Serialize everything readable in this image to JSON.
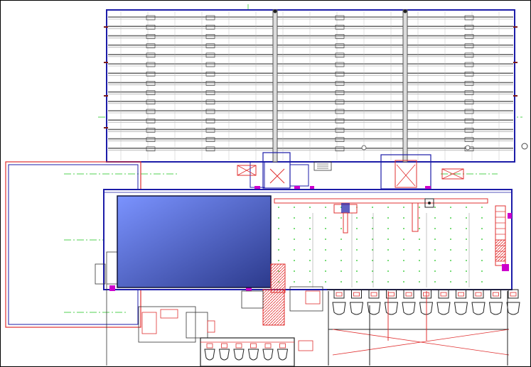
{
  "drawing": {
    "type": "cad-floor-plan",
    "colors": {
      "background": "#ffffff",
      "frame": "#000000",
      "wall_blue": "#1c1ca8",
      "grid_gray": "#7a7a7a",
      "detail_red": "#e03030",
      "axis_green": "#19c119",
      "block_light": "#7b93ff",
      "block_dark": "#2c3a8c"
    },
    "upper_hall": {
      "bays": 3,
      "purlin_rows": 15
    },
    "lower_hall": {
      "shaded_block": true,
      "dot_grid": true
    },
    "loading_docks": {
      "count_right": 11,
      "count_bottom": 6
    }
  }
}
